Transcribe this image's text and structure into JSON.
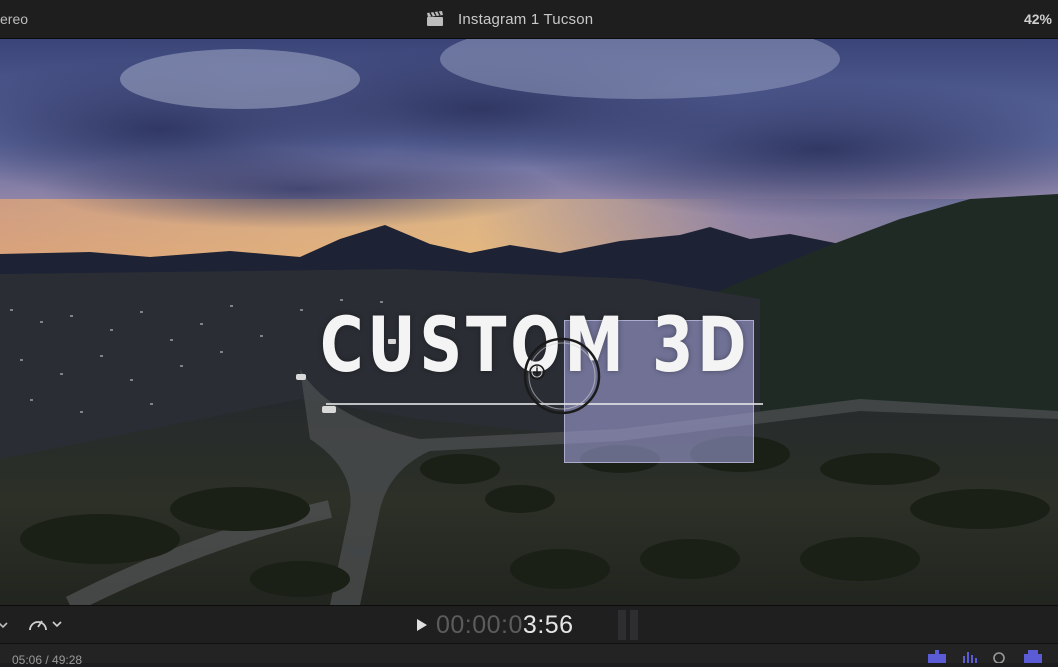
{
  "topbar": {
    "audio_mode": "ereo",
    "project_title": "Instagram 1 Tucson",
    "zoom_level": "42%"
  },
  "viewer": {
    "title_text": "CUSTOM 3D"
  },
  "controls": {
    "timecode_dim": "00:00:0",
    "timecode_bright": "3:56",
    "play_icon": "play-icon",
    "speed_icon": "speedometer-icon"
  },
  "timeline": {
    "duration": "05:06 / 49:28"
  },
  "colors": {
    "bar_background": "#1e1e1f",
    "selection_fill": "#aaaae6",
    "timeline_accent": "#5b5bd6"
  }
}
